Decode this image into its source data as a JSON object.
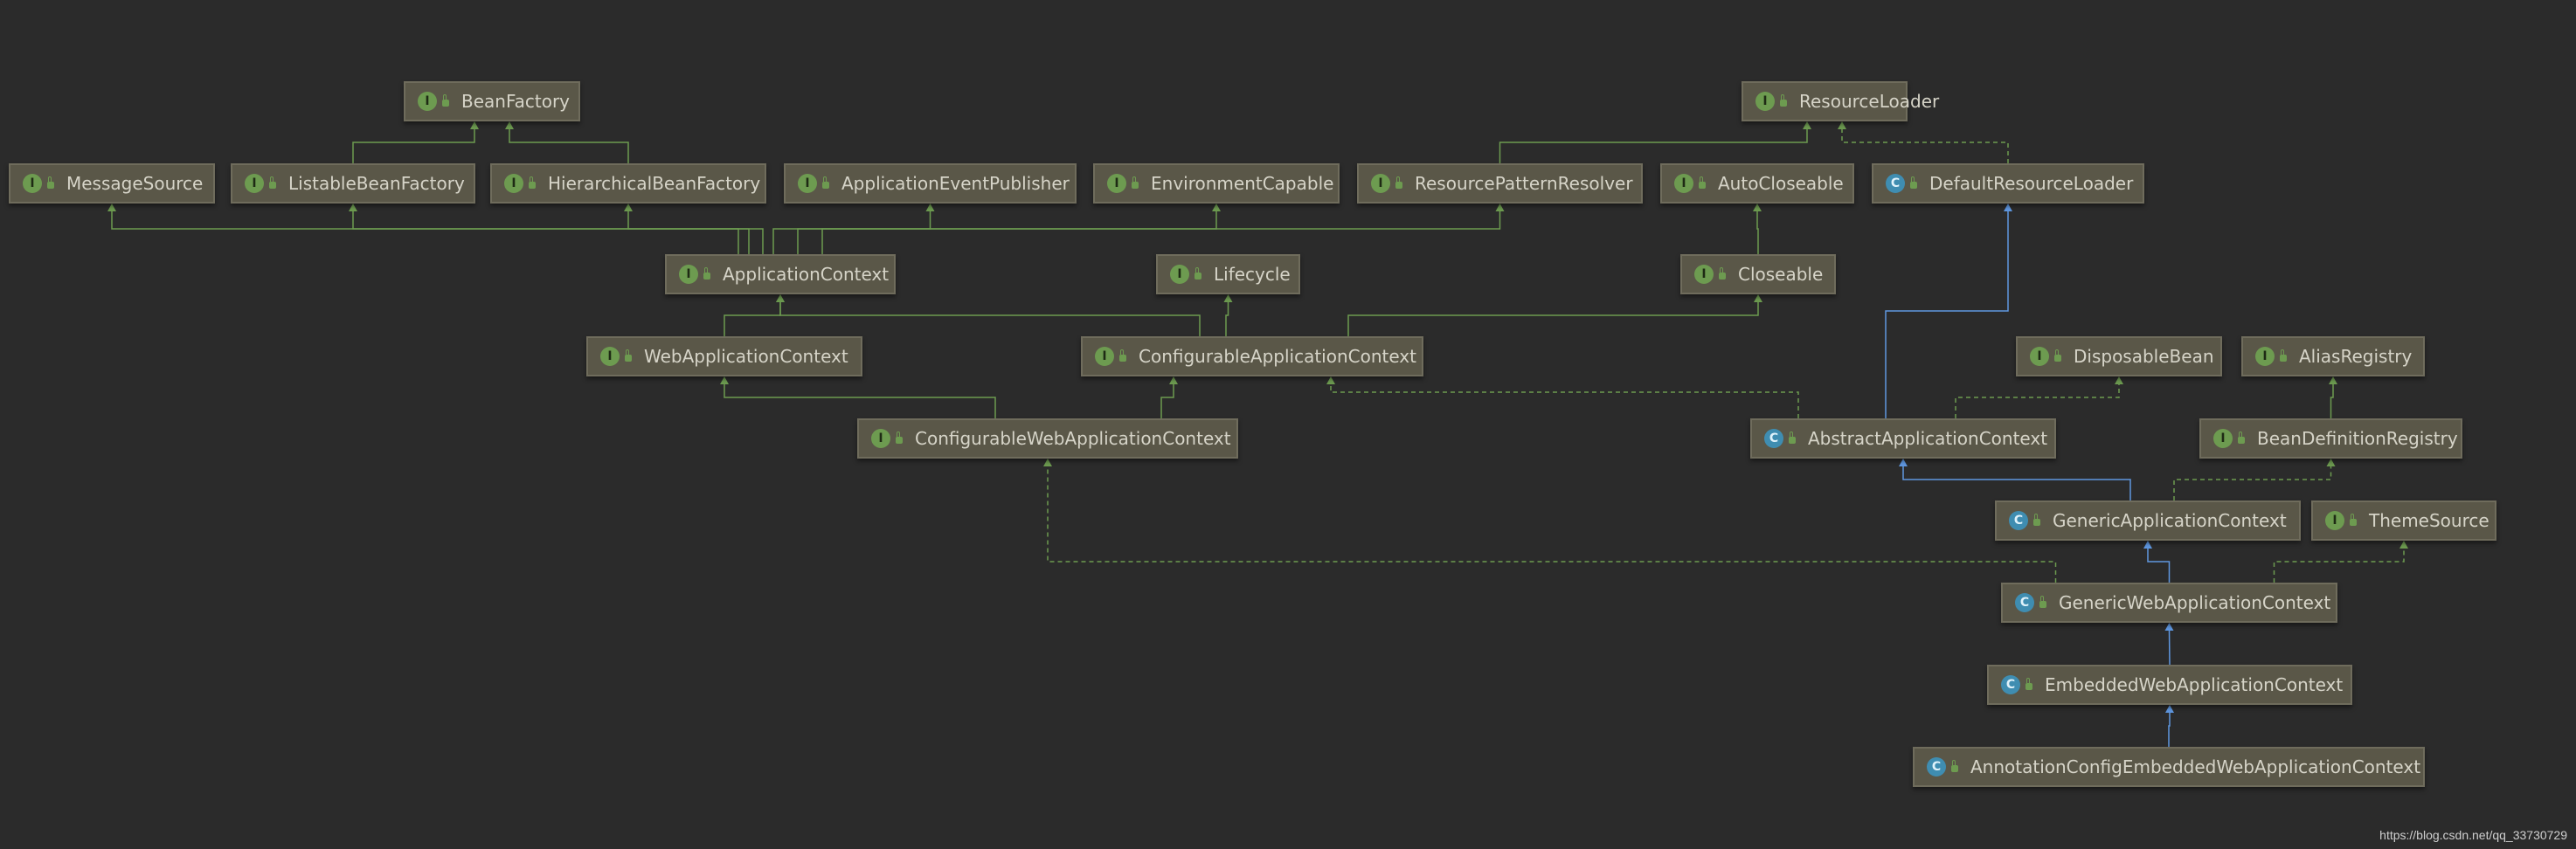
{
  "colors": {
    "background": "#2b2b2b",
    "node_fill": "#5a5748",
    "node_border": "#6f6c5c",
    "interface_badge": "#6d9b50",
    "class_badge": "#3f8db1",
    "extends_edge": "#6d9b50",
    "class_extends_edge": "#5f97e0",
    "implements_edge": "#6d9b50",
    "text": "#d6d4c8"
  },
  "nodes": {
    "bean_factory": {
      "kind": "I",
      "label": "BeanFactory"
    },
    "resource_loader": {
      "kind": "I",
      "label": "ResourceLoader"
    },
    "message_source": {
      "kind": "I",
      "label": "MessageSource"
    },
    "listable_bean_factory": {
      "kind": "I",
      "label": "ListableBeanFactory"
    },
    "hierarchical_bean_factory": {
      "kind": "I",
      "label": "HierarchicalBeanFactory"
    },
    "application_event_publisher": {
      "kind": "I",
      "label": "ApplicationEventPublisher"
    },
    "environment_capable": {
      "kind": "I",
      "label": "EnvironmentCapable"
    },
    "resource_pattern_resolver": {
      "kind": "I",
      "label": "ResourcePatternResolver"
    },
    "auto_closeable": {
      "kind": "I",
      "label": "AutoCloseable"
    },
    "default_resource_loader": {
      "kind": "C",
      "label": "DefaultResourceLoader"
    },
    "application_context": {
      "kind": "I",
      "label": "ApplicationContext"
    },
    "lifecycle": {
      "kind": "I",
      "label": "Lifecycle"
    },
    "closeable": {
      "kind": "I",
      "label": "Closeable"
    },
    "web_application_context": {
      "kind": "I",
      "label": "WebApplicationContext"
    },
    "configurable_application_context": {
      "kind": "I",
      "label": "ConfigurableApplicationContext"
    },
    "disposable_bean": {
      "kind": "I",
      "label": "DisposableBean"
    },
    "alias_registry": {
      "kind": "I",
      "label": "AliasRegistry"
    },
    "configurable_web_application_context": {
      "kind": "I",
      "label": "ConfigurableWebApplicationContext"
    },
    "abstract_application_context": {
      "kind": "C",
      "label": "AbstractApplicationContext"
    },
    "bean_definition_registry": {
      "kind": "I",
      "label": "BeanDefinitionRegistry"
    },
    "generic_application_context": {
      "kind": "C",
      "label": "GenericApplicationContext"
    },
    "theme_source": {
      "kind": "I",
      "label": "ThemeSource"
    },
    "generic_web_application_context": {
      "kind": "C",
      "label": "GenericWebApplicationContext"
    },
    "embedded_web_application_context": {
      "kind": "C",
      "label": "EmbeddedWebApplicationContext"
    },
    "annotation_config_embedded_web_application_context": {
      "kind": "C",
      "label": "AnnotationConfigEmbeddedWebApplicationContext"
    }
  },
  "edges": [
    {
      "from": "listable_bean_factory",
      "to": "bean_factory",
      "type": "extends"
    },
    {
      "from": "hierarchical_bean_factory",
      "to": "bean_factory",
      "type": "extends"
    },
    {
      "from": "resource_pattern_resolver",
      "to": "resource_loader",
      "type": "extends"
    },
    {
      "from": "default_resource_loader",
      "to": "resource_loader",
      "type": "implements"
    },
    {
      "from": "application_context",
      "to": "message_source",
      "type": "extends"
    },
    {
      "from": "application_context",
      "to": "listable_bean_factory",
      "type": "extends"
    },
    {
      "from": "application_context",
      "to": "hierarchical_bean_factory",
      "type": "extends"
    },
    {
      "from": "application_context",
      "to": "application_event_publisher",
      "type": "extends"
    },
    {
      "from": "application_context",
      "to": "environment_capable",
      "type": "extends"
    },
    {
      "from": "application_context",
      "to": "resource_pattern_resolver",
      "type": "extends"
    },
    {
      "from": "closeable",
      "to": "auto_closeable",
      "type": "extends"
    },
    {
      "from": "web_application_context",
      "to": "application_context",
      "type": "extends"
    },
    {
      "from": "configurable_application_context",
      "to": "application_context",
      "type": "extends"
    },
    {
      "from": "configurable_application_context",
      "to": "lifecycle",
      "type": "extends"
    },
    {
      "from": "configurable_application_context",
      "to": "closeable",
      "type": "extends"
    },
    {
      "from": "configurable_web_application_context",
      "to": "web_application_context",
      "type": "extends"
    },
    {
      "from": "configurable_web_application_context",
      "to": "configurable_application_context",
      "type": "extends"
    },
    {
      "from": "abstract_application_context",
      "to": "default_resource_loader",
      "type": "class_extends"
    },
    {
      "from": "abstract_application_context",
      "to": "configurable_application_context",
      "type": "implements"
    },
    {
      "from": "abstract_application_context",
      "to": "disposable_bean",
      "type": "implements"
    },
    {
      "from": "bean_definition_registry",
      "to": "alias_registry",
      "type": "extends"
    },
    {
      "from": "generic_application_context",
      "to": "abstract_application_context",
      "type": "class_extends"
    },
    {
      "from": "generic_application_context",
      "to": "bean_definition_registry",
      "type": "implements"
    },
    {
      "from": "generic_web_application_context",
      "to": "generic_application_context",
      "type": "class_extends"
    },
    {
      "from": "generic_web_application_context",
      "to": "configurable_web_application_context",
      "type": "implements"
    },
    {
      "from": "generic_web_application_context",
      "to": "theme_source",
      "type": "implements"
    },
    {
      "from": "embedded_web_application_context",
      "to": "generic_web_application_context",
      "type": "class_extends"
    },
    {
      "from": "annotation_config_embedded_web_application_context",
      "to": "embedded_web_application_context",
      "type": "class_extends"
    }
  ],
  "watermark": "https://blog.csdn.net/qq_33730729"
}
